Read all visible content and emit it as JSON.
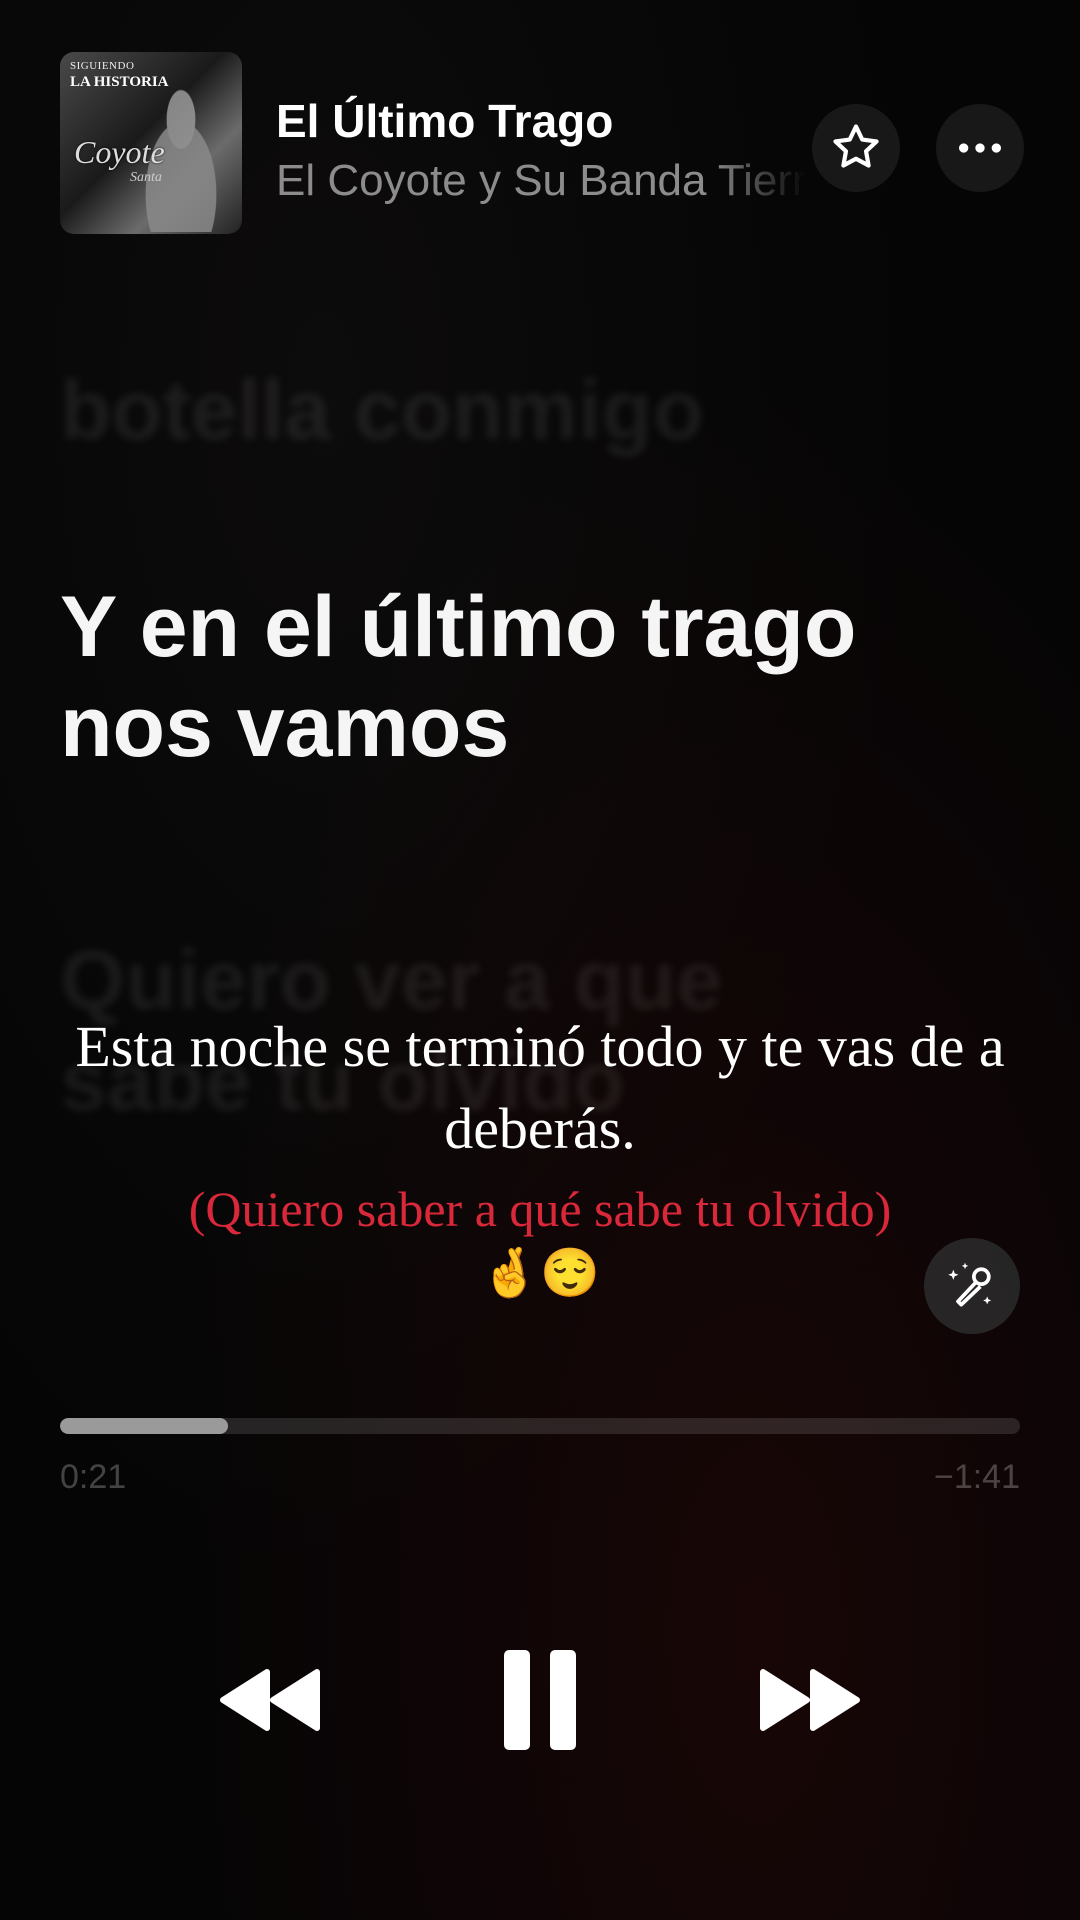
{
  "header": {
    "album_art": {
      "label_top": "SIGUIENDO",
      "label_main": "LA HISTORIA",
      "logo": "Coyote",
      "sub": "Santa"
    },
    "title": "El Último Trago",
    "artist": "El Coyote y Su Banda Tierra Santa",
    "favorite_icon": "star-outline-icon",
    "more_icon": "ellipsis-icon"
  },
  "lyrics": {
    "previous": "botella conmigo",
    "current": [
      "Y en el último trago",
      "nos vamos"
    ],
    "next": "Quiero ver a que sabe tu olvido"
  },
  "caption": {
    "main": "Esta noche se terminó todo y te vas de a deberás.",
    "sub": "(Quiero saber a qué sabe tu olvido)",
    "emoji": "🤞😌"
  },
  "sing_button": {
    "icon": "microphone-sparkle-icon"
  },
  "playback": {
    "elapsed": "0:21",
    "remaining": "−1:41",
    "progress_fraction": 0.175
  },
  "controls": {
    "rewind_icon": "backward-icon",
    "pause_icon": "pause-icon",
    "forward_icon": "forward-icon"
  },
  "colors": {
    "background": "#050505",
    "caption_accent": "#d8283a",
    "progress_fill": "#9a9a9a"
  }
}
